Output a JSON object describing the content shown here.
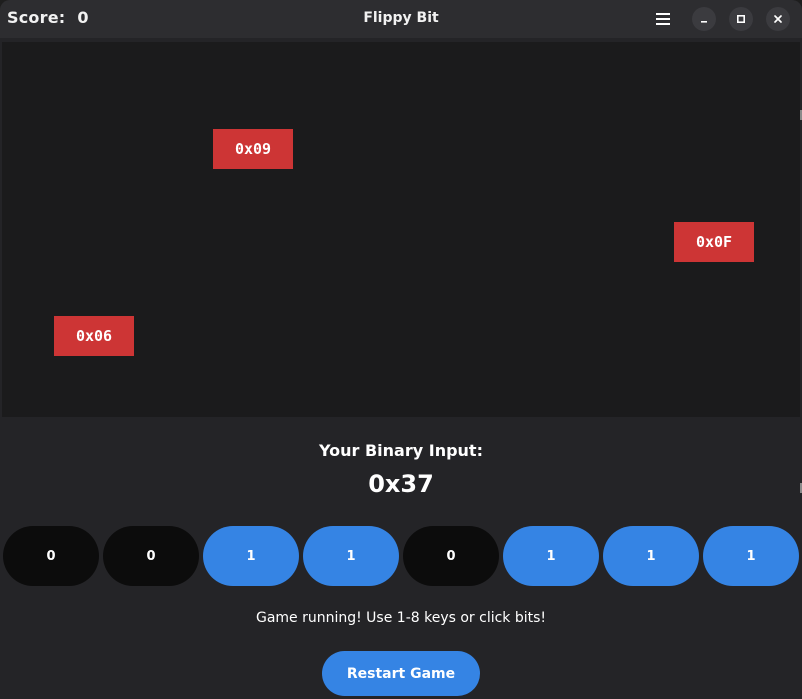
{
  "titlebar": {
    "score_label": "Score:",
    "score_value": "0",
    "title": "Flippy Bit",
    "menu_icon": "hamburger-menu-icon",
    "minimize_icon": "minimize-icon",
    "maximize_icon": "maximize-icon",
    "close_icon": "close-icon"
  },
  "enemies": [
    {
      "label": "0x09"
    },
    {
      "label": "0x0F"
    },
    {
      "label": "0x06"
    }
  ],
  "input": {
    "label": "Your Binary Input:",
    "hex": "0x37"
  },
  "bits": [
    {
      "value": "0",
      "on": false
    },
    {
      "value": "0",
      "on": false
    },
    {
      "value": "1",
      "on": true
    },
    {
      "value": "1",
      "on": true
    },
    {
      "value": "0",
      "on": false
    },
    {
      "value": "1",
      "on": true
    },
    {
      "value": "1",
      "on": true
    },
    {
      "value": "1",
      "on": true
    }
  ],
  "status": "Game running! Use 1-8 keys or click bits!",
  "restart_label": "Restart Game",
  "colors": {
    "enemy": "#cd3535",
    "bit_on": "#3584e4",
    "bit_off": "#0c0c0c",
    "play_area": "#1b1b1c",
    "panel": "#242427"
  }
}
